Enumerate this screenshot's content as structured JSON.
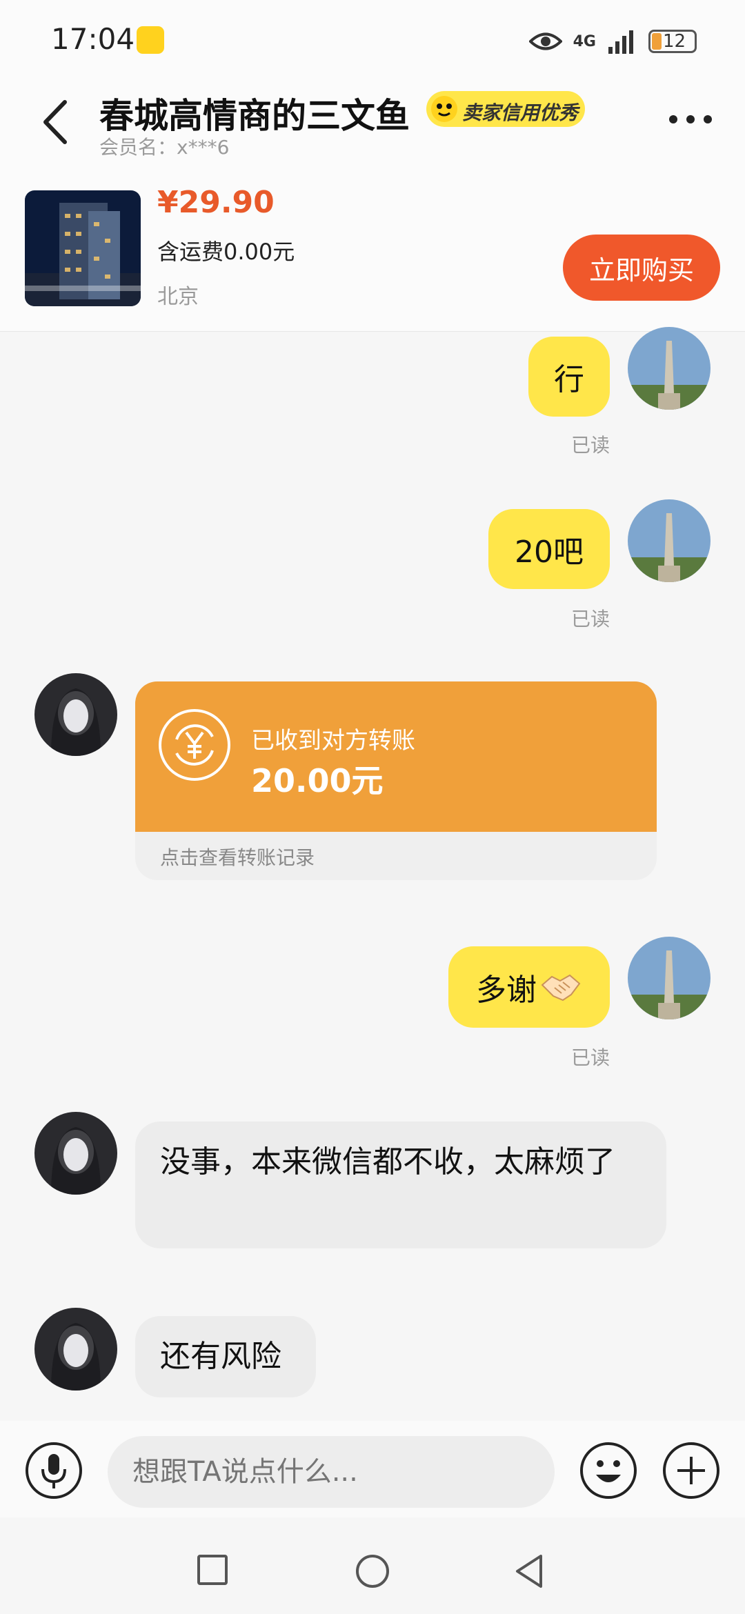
{
  "status_bar": {
    "time": "17:04",
    "network": "4G",
    "battery": "12"
  },
  "header": {
    "title": "春城高情商的三文鱼",
    "seller_badge": "卖家信用优秀",
    "member_name": "会员名：x***6"
  },
  "product": {
    "price": "¥29.90",
    "shipping": "含运费0.00元",
    "location": "北京",
    "buy_label": "立即购买"
  },
  "messages": {
    "m1_text": "行",
    "m1_read": "已读",
    "m2_text": "20吧",
    "m2_read": "已读",
    "transfer_title": "已收到对方转账",
    "transfer_amount": "20.00元",
    "transfer_link": "点击查看转账记录",
    "m4_text": "多谢",
    "m4_read": "已读",
    "m5_text": "没事，本来微信都不收，太麻烦了",
    "m6_text": "还有风险"
  },
  "input": {
    "placeholder": "想跟TA说点什么..."
  },
  "colors": {
    "accent_yellow": "#ffe64a",
    "buy_orange": "#f0582b",
    "transfer_orange": "#f0a03a",
    "price_red": "#e85a2a"
  }
}
